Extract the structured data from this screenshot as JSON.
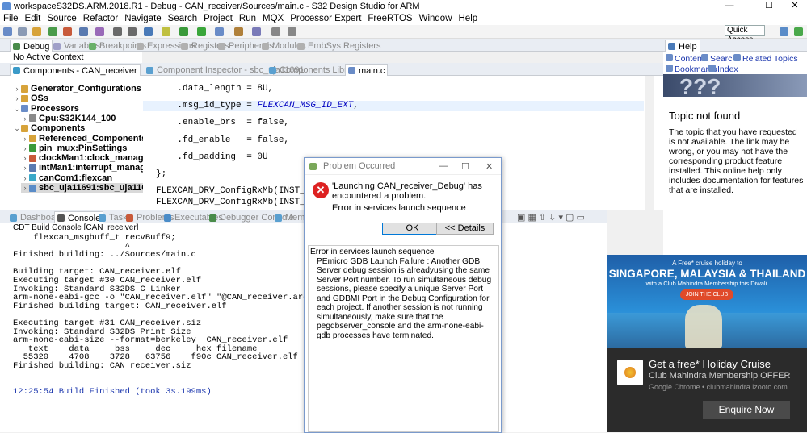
{
  "window": {
    "title": "workspaceS32DS.ARM.2018.R1 - Debug - CAN_receiver/Sources/main.c - S32 Design Studio for ARM",
    "controls": [
      "—",
      "☐",
      "✕"
    ]
  },
  "menubar": [
    "File",
    "Edit",
    "Source",
    "Refactor",
    "Navigate",
    "Search",
    "Project",
    "Run",
    "MQX",
    "Processor Expert",
    "FreeRTOS",
    "Window",
    "Help"
  ],
  "toolbar": {
    "quick_access": "Quick Access"
  },
  "top_tabs": [
    "Debug",
    "Variables",
    "Breakpoints",
    "Expressions",
    "Registers",
    "Peripherals",
    "Modules",
    "EmbSys Registers"
  ],
  "debug_view": {
    "status": "No Active Context"
  },
  "components_panel": {
    "tab": "Components - CAN_receiver",
    "tree": [
      {
        "label": "Generator_Configurations",
        "level": 1,
        "twisty": ">",
        "bold": true
      },
      {
        "label": "OSs",
        "level": 1,
        "twisty": ">",
        "bold": true
      },
      {
        "label": "Processors",
        "level": 1,
        "twisty": "v",
        "bold": true
      },
      {
        "label": "Cpu:S32K144_100",
        "level": 2,
        "twisty": ">",
        "bold": true
      },
      {
        "label": "Components",
        "level": 1,
        "twisty": "v",
        "bold": true
      },
      {
        "label": "Referenced_Components",
        "level": 2,
        "twisty": ">",
        "bold": true
      },
      {
        "label": "pin_mux:PinSettings",
        "level": 2,
        "twisty": ">",
        "bold": true
      },
      {
        "label": "clockMan1:clock_manager",
        "level": 2,
        "twisty": ">",
        "bold": true
      },
      {
        "label": "intMan1:interrupt_manager",
        "level": 2,
        "twisty": ">",
        "bold": true
      },
      {
        "label": "canCom1:flexcan",
        "level": 2,
        "twisty": ">",
        "bold": true
      },
      {
        "label": "sbc_uja11691:sbc_uja1169",
        "level": 2,
        "twisty": ">",
        "bold": true,
        "selected": true
      }
    ]
  },
  "editor_tabs": [
    "Component Inspector - sbc_uja11691",
    "Components Library",
    "main.c"
  ],
  "editor": {
    "lines": [
      {
        "pre": "    .data_length = 8U,",
        "it": ""
      },
      {
        "pre": "    .msg_id_type = ",
        "it": "FLEXCAN_MSG_ID_EXT",
        "post": ","
      },
      {
        "pre": "    .enable_brs  = false,",
        "it": ""
      },
      {
        "pre": "    .fd_enable   = false,",
        "it": ""
      },
      {
        "pre": "    .fd_padding  = 0U",
        "it": ""
      },
      {
        "pre": "};",
        "it": ""
      },
      {
        "pre": "FLEXCAN_DRV_ConfigRxMb(INST_CANCOM1,MB,",
        "it": ""
      },
      {
        "pre": "FLEXCAN_DRV_ConfigRxMb(INST_CANCOM1,MB2",
        "it": ""
      }
    ]
  },
  "help_panel": {
    "tab": "Help",
    "links": [
      "Contents",
      "Search",
      "Related Topics",
      "Bookmarks",
      "Index"
    ],
    "heading": "Topic not found",
    "body": "The topic that you have requested is not available. The link may be wrong, or you may not have the corresponding product feature installed. This online help only includes documentation for features that are installed."
  },
  "bottom_tabs": [
    "Dashboard",
    "Console",
    "Tasks",
    "Problems",
    "Executables",
    "Debugger Console",
    "Memory"
  ],
  "console": {
    "header": "CDT Build Console [CAN_receiver]",
    "lines": [
      "    flexcan_msgbuff_t recvBuff9;",
      "                      ^",
      "Finished building: ../Sources/main.c",
      "",
      "Building target: CAN_receiver.elf",
      "Executing target #30 CAN_receiver.elf",
      "Invoking: Standard S32DS C Linker",
      "arm-none-eabi-gcc -o \"CAN_receiver.elf\" \"@CAN_receiver.args\"",
      "Finished building target: CAN_receiver.elf",
      "",
      "Executing target #31 CAN_receiver.siz",
      "Invoking: Standard S32DS Print Size",
      "arm-none-eabi-size --format=berkeley  CAN_receiver.elf",
      "   text    data     bss     dec     hex filename",
      "  55320    4708    3728   63756    f90c CAN_receiver.elf",
      "Finished building: CAN_receiver.siz",
      "",
      "",
      "12:25:54 Build Finished (took 3s.199ms)"
    ]
  },
  "dialog": {
    "title": "Problem Occurred",
    "message": "'Launching CAN_receiver_Debug' has encountered a problem.",
    "sub": "Error in services launch sequence",
    "ok": "OK",
    "details": "<< Details",
    "details_title": "Error in services launch sequence",
    "details_body": "PEmicro GDB Launch Failure : Another GDB Server debug session is alreadyusing the same Server Port number. To run simultaneous debug sessions, please specify a unique Server Port and GDBMI Port in the Debug Configuration for each project. If another session is not running simultaneously, make sure that the pegdbserver_console and the arm-none-eabi-gdb processes have terminated."
  },
  "ad": {
    "top": "A Free* cruise holiday to",
    "headline": "SINGAPORE, MALAYSIA & THAILAND",
    "sub": "with a Club Mahindra Membership this Diwali.",
    "join": "JOIN THE CLUB",
    "title": "Get a free* Holiday Cruise",
    "subtitle": "Club Mahindra Membership OFFER",
    "source": "Google Chrome • clubmahindra.izooto.com",
    "cta": "Enquire Now"
  }
}
